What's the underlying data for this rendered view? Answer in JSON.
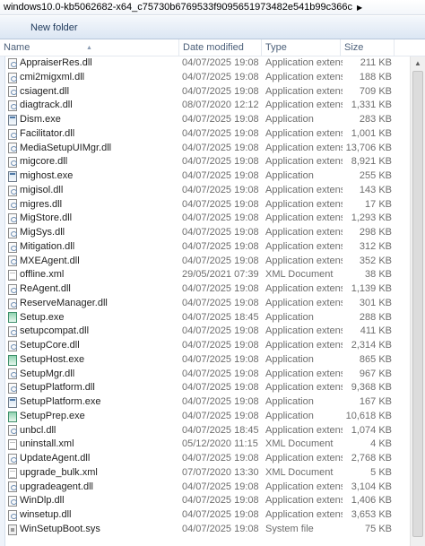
{
  "address": {
    "path": "windows10.0-kb5062682-x64_c75730b6769533f9095651973482e541b99c366c"
  },
  "toolbar": {
    "new_folder": "New folder"
  },
  "columns": {
    "name": "Name",
    "date": "Date modified",
    "type": "Type",
    "size": "Size"
  },
  "files": [
    {
      "name": "AppraiserRes.dll",
      "date": "04/07/2025 19:08",
      "type": "Application extens...",
      "size": "211 KB",
      "icon": "dll-icon"
    },
    {
      "name": "cmi2migxml.dll",
      "date": "04/07/2025 19:08",
      "type": "Application extens...",
      "size": "188 KB",
      "icon": "dll-icon"
    },
    {
      "name": "csiagent.dll",
      "date": "04/07/2025 19:08",
      "type": "Application extens...",
      "size": "709 KB",
      "icon": "dll-icon"
    },
    {
      "name": "diagtrack.dll",
      "date": "08/07/2020 12:12",
      "type": "Application extens...",
      "size": "1,331 KB",
      "icon": "dll-icon"
    },
    {
      "name": "Dism.exe",
      "date": "04/07/2025 19:08",
      "type": "Application",
      "size": "283 KB",
      "icon": "exe-icon"
    },
    {
      "name": "Facilitator.dll",
      "date": "04/07/2025 19:08",
      "type": "Application extens...",
      "size": "1,001 KB",
      "icon": "dll-icon"
    },
    {
      "name": "MediaSetupUIMgr.dll",
      "date": "04/07/2025 19:08",
      "type": "Application extens...",
      "size": "13,706 KB",
      "icon": "dll-icon"
    },
    {
      "name": "migcore.dll",
      "date": "04/07/2025 19:08",
      "type": "Application extens...",
      "size": "8,921 KB",
      "icon": "dll-icon"
    },
    {
      "name": "mighost.exe",
      "date": "04/07/2025 19:08",
      "type": "Application",
      "size": "255 KB",
      "icon": "exe-icon"
    },
    {
      "name": "migisol.dll",
      "date": "04/07/2025 19:08",
      "type": "Application extens...",
      "size": "143 KB",
      "icon": "dll-icon"
    },
    {
      "name": "migres.dll",
      "date": "04/07/2025 19:08",
      "type": "Application extens...",
      "size": "17 KB",
      "icon": "dll-icon"
    },
    {
      "name": "MigStore.dll",
      "date": "04/07/2025 19:08",
      "type": "Application extens...",
      "size": "1,293 KB",
      "icon": "dll-icon"
    },
    {
      "name": "MigSys.dll",
      "date": "04/07/2025 19:08",
      "type": "Application extens...",
      "size": "298 KB",
      "icon": "dll-icon"
    },
    {
      "name": "Mitigation.dll",
      "date": "04/07/2025 19:08",
      "type": "Application extens...",
      "size": "312 KB",
      "icon": "dll-icon"
    },
    {
      "name": "MXEAgent.dll",
      "date": "04/07/2025 19:08",
      "type": "Application extens...",
      "size": "352 KB",
      "icon": "dll-icon"
    },
    {
      "name": "offline.xml",
      "date": "29/05/2021 07:39",
      "type": "XML Document",
      "size": "38 KB",
      "icon": "xml-icon"
    },
    {
      "name": "ReAgent.dll",
      "date": "04/07/2025 19:08",
      "type": "Application extens...",
      "size": "1,139 KB",
      "icon": "dll-icon"
    },
    {
      "name": "ReserveManager.dll",
      "date": "04/07/2025 19:08",
      "type": "Application extens...",
      "size": "301 KB",
      "icon": "dll-icon"
    },
    {
      "name": "Setup.exe",
      "date": "04/07/2025 18:45",
      "type": "Application",
      "size": "288 KB",
      "icon": "setup-icon"
    },
    {
      "name": "setupcompat.dll",
      "date": "04/07/2025 19:08",
      "type": "Application extens...",
      "size": "411 KB",
      "icon": "dll-icon"
    },
    {
      "name": "SetupCore.dll",
      "date": "04/07/2025 19:08",
      "type": "Application extens...",
      "size": "2,314 KB",
      "icon": "dll-icon"
    },
    {
      "name": "SetupHost.exe",
      "date": "04/07/2025 19:08",
      "type": "Application",
      "size": "865 KB",
      "icon": "setup-icon"
    },
    {
      "name": "SetupMgr.dll",
      "date": "04/07/2025 19:08",
      "type": "Application extens...",
      "size": "967 KB",
      "icon": "dll-icon"
    },
    {
      "name": "SetupPlatform.dll",
      "date": "04/07/2025 19:08",
      "type": "Application extens...",
      "size": "9,368 KB",
      "icon": "dll-icon"
    },
    {
      "name": "SetupPlatform.exe",
      "date": "04/07/2025 19:08",
      "type": "Application",
      "size": "167 KB",
      "icon": "exe-icon"
    },
    {
      "name": "SetupPrep.exe",
      "date": "04/07/2025 19:08",
      "type": "Application",
      "size": "10,618 KB",
      "icon": "setup-icon"
    },
    {
      "name": "unbcl.dll",
      "date": "04/07/2025 18:45",
      "type": "Application extens...",
      "size": "1,074 KB",
      "icon": "dll-icon"
    },
    {
      "name": "uninstall.xml",
      "date": "05/12/2020 11:15",
      "type": "XML Document",
      "size": "4 KB",
      "icon": "xml-icon"
    },
    {
      "name": "UpdateAgent.dll",
      "date": "04/07/2025 19:08",
      "type": "Application extens...",
      "size": "2,768 KB",
      "icon": "dll-icon"
    },
    {
      "name": "upgrade_bulk.xml",
      "date": "07/07/2020 13:30",
      "type": "XML Document",
      "size": "5 KB",
      "icon": "xml-icon"
    },
    {
      "name": "upgradeagent.dll",
      "date": "04/07/2025 19:08",
      "type": "Application extens...",
      "size": "3,104 KB",
      "icon": "dll-icon"
    },
    {
      "name": "WinDlp.dll",
      "date": "04/07/2025 19:08",
      "type": "Application extens...",
      "size": "1,406 KB",
      "icon": "dll-icon"
    },
    {
      "name": "winsetup.dll",
      "date": "04/07/2025 19:08",
      "type": "Application extens...",
      "size": "3,653 KB",
      "icon": "dll-icon"
    },
    {
      "name": "WinSetupBoot.sys",
      "date": "04/07/2025 19:08",
      "type": "System file",
      "size": "75 KB",
      "icon": "sys-icon"
    }
  ]
}
